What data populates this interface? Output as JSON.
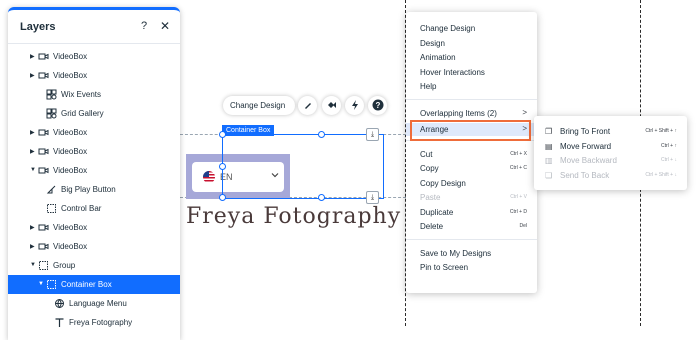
{
  "layers_panel": {
    "title": "Layers",
    "help_glyph": "?",
    "close_glyph": "✕",
    "items": [
      {
        "label": "VideoBox",
        "icon": "video-icon",
        "expand": "collapsed"
      },
      {
        "label": "VideoBox",
        "icon": "video-icon",
        "expand": "collapsed"
      },
      {
        "label": "Wix Events",
        "icon": "app-icon",
        "expand": "none"
      },
      {
        "label": "Grid Gallery",
        "icon": "app-icon",
        "expand": "none"
      },
      {
        "label": "VideoBox",
        "icon": "video-icon",
        "expand": "collapsed"
      },
      {
        "label": "VideoBox",
        "icon": "video-icon",
        "expand": "collapsed"
      },
      {
        "label": "VideoBox",
        "icon": "video-icon",
        "expand": "expanded"
      },
      {
        "label": "Big Play Button",
        "icon": "play-button-icon",
        "expand": "none"
      },
      {
        "label": "Control Bar",
        "icon": "box-icon",
        "expand": "none"
      },
      {
        "label": "VideoBox",
        "icon": "video-icon",
        "expand": "collapsed"
      },
      {
        "label": "VideoBox",
        "icon": "video-icon",
        "expand": "collapsed"
      },
      {
        "label": "Group",
        "icon": "group-icon",
        "expand": "expanded"
      },
      {
        "label": "Container Box",
        "icon": "box-icon",
        "expand": "expanded",
        "selected": true
      },
      {
        "label": "Language Menu",
        "icon": "globe-icon",
        "expand": "none"
      },
      {
        "label": "Freya Fotography",
        "icon": "text-icon",
        "expand": "none"
      }
    ]
  },
  "canvas": {
    "container_label": "Container Box",
    "language_code": "EN",
    "site_title": "Freya Fotography"
  },
  "toolbar": {
    "change_design_label": "Change Design"
  },
  "context_menu": {
    "groups": [
      [
        {
          "label": "Change Design"
        },
        {
          "label": "Design"
        },
        {
          "label": "Animation"
        },
        {
          "label": "Hover Interactions"
        },
        {
          "label": "Help"
        }
      ],
      [
        {
          "label": "Overlapping Items (2)",
          "arrow": ">"
        },
        {
          "label": "Arrange",
          "arrow": ">",
          "highlighted": true
        }
      ],
      [
        {
          "label": "Cut",
          "shortcut": "Ctrl + X"
        },
        {
          "label": "Copy",
          "shortcut": "Ctrl + C"
        },
        {
          "label": "Copy Design"
        },
        {
          "label": "Paste",
          "shortcut": "Ctrl + V",
          "disabled": true
        },
        {
          "label": "Duplicate",
          "shortcut": "Ctrl + D"
        },
        {
          "label": "Delete",
          "shortcut": "Del"
        }
      ],
      [
        {
          "label": "Save to My Designs"
        },
        {
          "label": "Pin to Screen"
        }
      ]
    ]
  },
  "arrange_submenu": {
    "items": [
      {
        "label": "Bring To Front",
        "shortcut": "Ctrl + Shift + ↑",
        "icon": "bring-to-front-icon"
      },
      {
        "label": "Move Forward",
        "shortcut": "Ctrl + ↑",
        "icon": "move-forward-icon"
      },
      {
        "label": "Move Backward",
        "shortcut": "Ctrl + ↓",
        "icon": "move-backward-icon",
        "disabled": true
      },
      {
        "label": "Send To Back",
        "shortcut": "Ctrl + Shift + ↓",
        "icon": "send-to-back-icon",
        "disabled": true
      }
    ]
  },
  "colors": {
    "accent": "#116dff",
    "highlight_outline": "#ef6c3a",
    "selection_overlay": "#a6a8d8"
  }
}
